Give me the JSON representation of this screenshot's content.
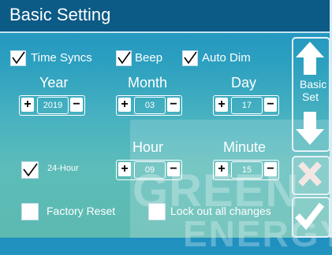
{
  "title": "Basic Setting",
  "checkboxes": {
    "time_syncs": {
      "label": "Time Syncs",
      "checked": true
    },
    "beep": {
      "label": "Beep",
      "checked": true
    },
    "auto_dim": {
      "label": "Auto Dim",
      "checked": true
    },
    "hour24": {
      "label": "24-Hour",
      "checked": true
    },
    "factory_reset": {
      "label": "Factory Reset",
      "checked": false
    },
    "lock_out": {
      "label": "Lock out all changes",
      "checked": false
    }
  },
  "date": {
    "year": {
      "label": "Year",
      "value": "2019"
    },
    "month": {
      "label": "Month",
      "value": "03"
    },
    "day": {
      "label": "Day",
      "value": "17"
    }
  },
  "time": {
    "hour": {
      "label": "Hour",
      "value": "09"
    },
    "minute": {
      "label": "Minute",
      "value": "15"
    }
  },
  "stepper": {
    "plus": "+",
    "minus": "−"
  },
  "right_panel": {
    "basic_set_line1": "Basic",
    "basic_set_line2": "Set"
  },
  "watermark": {
    "line1": "GREEN",
    "line2": "ENERGY"
  },
  "icons": {
    "up": "arrow-up-icon",
    "down": "arrow-down-icon",
    "cancel": "close-icon",
    "confirm": "checkmark-icon"
  }
}
